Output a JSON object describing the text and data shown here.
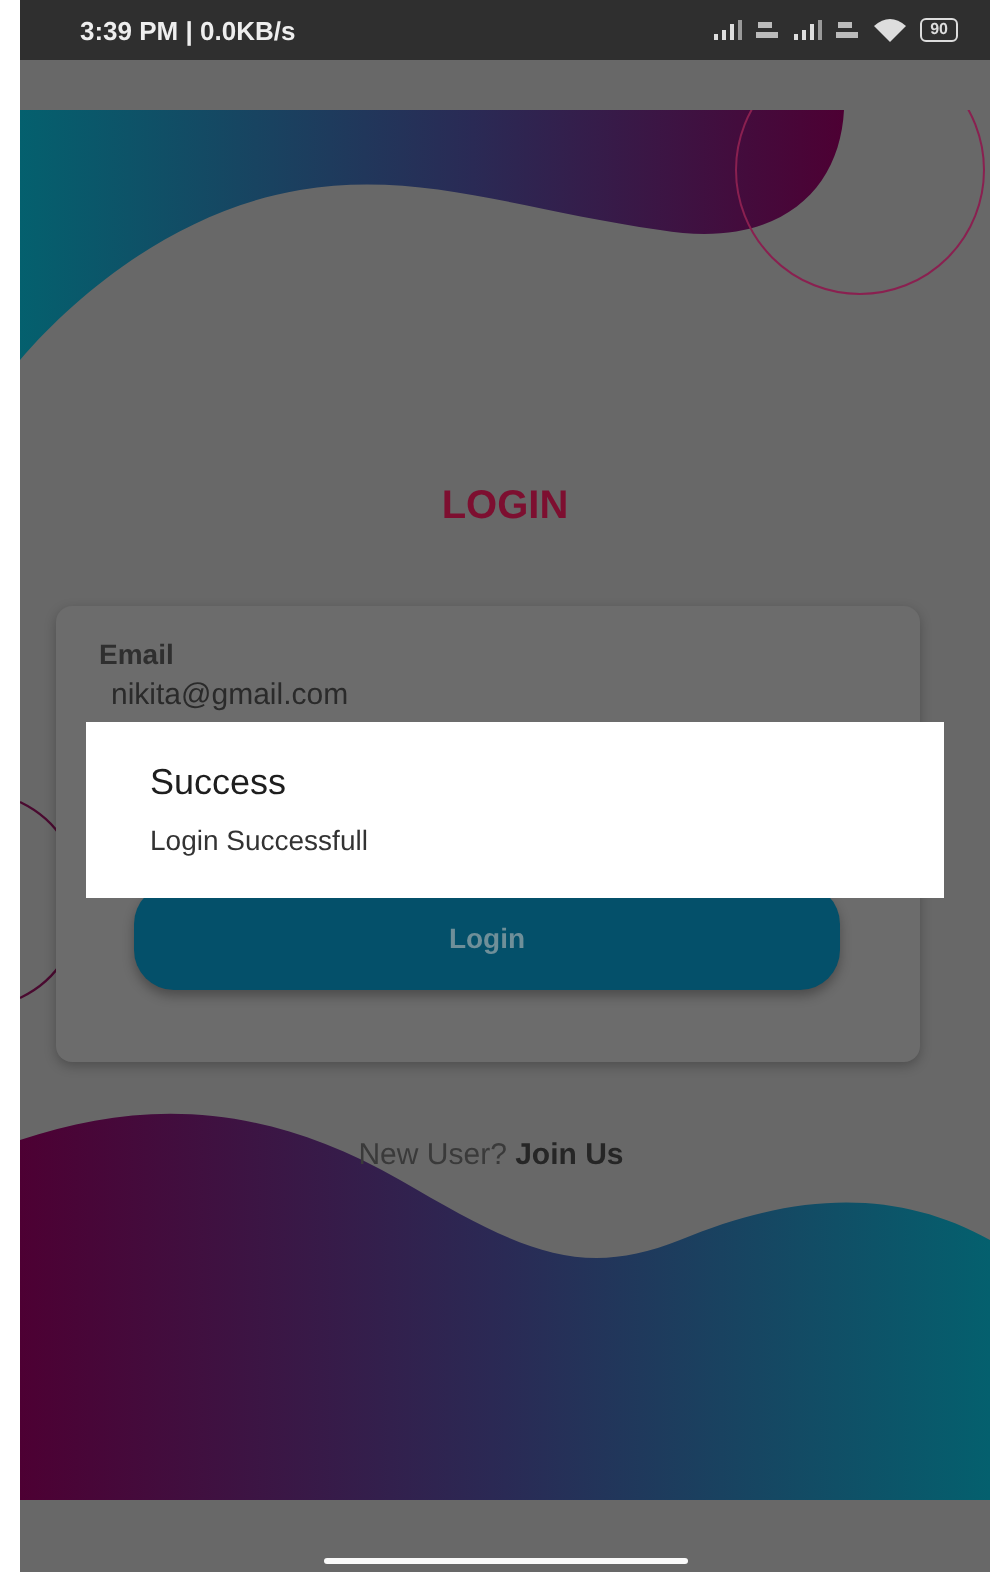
{
  "status_bar": {
    "time": "3:39 PM | 0.0KB/s",
    "battery": "90"
  },
  "title": "LOGIN",
  "form": {
    "email_label": "Email",
    "email_value": "nikita@gmail.com",
    "login_button": "Login"
  },
  "signup": {
    "prompt": "New User?",
    "link": "Join Us"
  },
  "dialog": {
    "title": "Success",
    "message": "Login Successfull"
  }
}
